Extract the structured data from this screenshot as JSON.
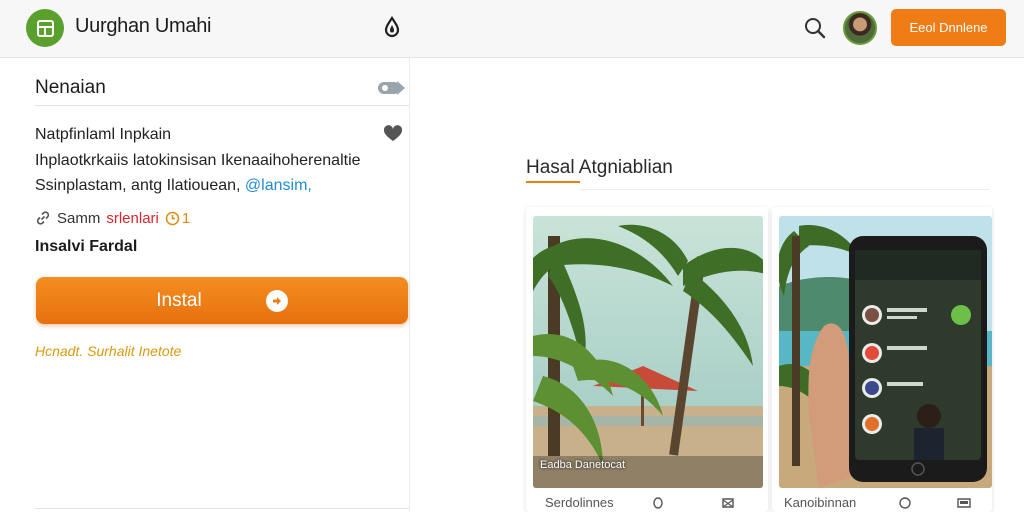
{
  "header": {
    "app_title": "Uurghan Umahi",
    "cta_label": "Eeol Dnnlene",
    "icons": [
      "logo-icon",
      "drop-icon",
      "search-icon",
      "avatar"
    ]
  },
  "left_panel": {
    "section_title": "Nenaian",
    "desc_line1": "Natpfinlaml Inpkain",
    "desc_line2": "Ihplaotkrkaiis latokinsisan Ikenaaihoherenaltie",
    "desc_line3_text": "Ssinplastam, antg Ilatiouean,",
    "desc_line3_link": "@lansim,",
    "meta_name": "Samm",
    "meta_tag": "srlenlari",
    "meta_count": "1",
    "label_strong": "Insalvi Fardal",
    "install_label": "Instal",
    "foot_note": "Hcnadt. Surhalit Inetote"
  },
  "gallery": {
    "title": "Hasal Atgniablian",
    "cards": [
      {
        "caption": "Eadba Danetocat",
        "footer_name": "Serdolinnes"
      },
      {
        "caption": "",
        "footer_name": "Kanoibinnan"
      }
    ]
  },
  "colors": {
    "accent_orange": "#ef7c14",
    "logo_green": "#5aa02c",
    "link_blue": "#1f8bd6",
    "tag_red": "#d8262e"
  }
}
